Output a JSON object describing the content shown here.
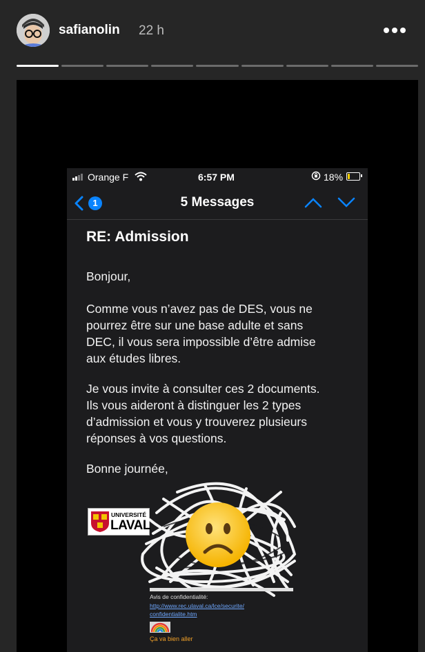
{
  "header": {
    "username": "safianolin",
    "time_ago": "22 h",
    "more_icon": "more-horizontal-icon",
    "progress_segments": 9,
    "active_segment": 1
  },
  "phone": {
    "status": {
      "carrier": "Orange F",
      "time": "6:57 PM",
      "battery": "18%",
      "battery_level": 0.18
    },
    "nav": {
      "back_count": "1",
      "title": "5 Messages"
    },
    "email": {
      "subject": "RE:  Admission",
      "greeting": "Bonjour,",
      "para1": [
        "Comme vous n’avez pas de DES, vous ne",
        "pourrez être sur une base adulte et sans",
        "DEC, il vous sera impossible d’être admise",
        "aux études libres."
      ],
      "para2": [
        "Je vous invite à consulter ces 2 documents.",
        "Ils  vous aideront à distinguer les 2 types",
        "d’admission et vous y trouverez plusieurs",
        "réponses à vos questions."
      ],
      "closing": "Bonne journée,",
      "signature": {
        "logo_top": "UNIVERSITÉ",
        "logo_bottom": "LAVAL",
        "confidentiality_label": "Avis de confidentialité:",
        "link1": "http://www.rec.ulaval.ca/lce/securite/",
        "link2": "confidentialite.htm",
        "tagline": "Ça va bien aller"
      }
    }
  },
  "colors": {
    "accent": "#0a84ff",
    "link": "#6fa8ff",
    "tagline": "#f0a028"
  }
}
